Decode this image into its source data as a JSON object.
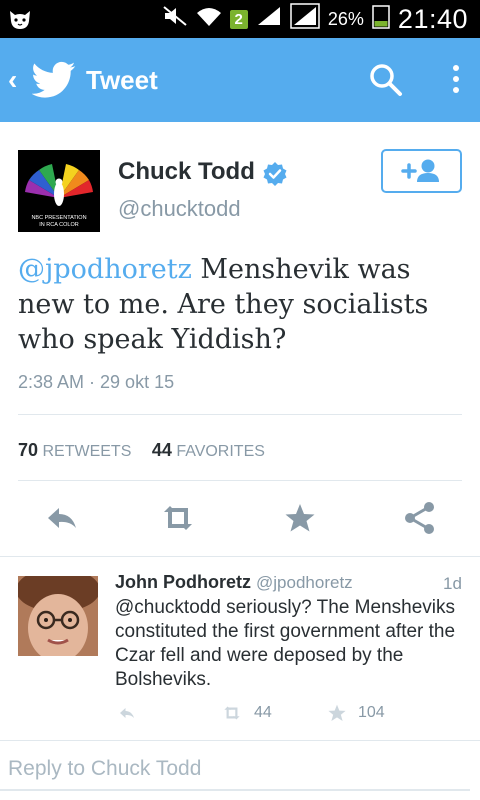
{
  "status_bar": {
    "app_icon": "cat-face-icon",
    "notification_badge": "2",
    "battery_percent": "26%",
    "time": "21:40"
  },
  "app_bar": {
    "title": "Tweet",
    "background_color": "#55acee"
  },
  "tweet": {
    "author_name": "Chuck Todd",
    "author_handle": "@chucktodd",
    "verified": true,
    "avatar_caption_line1": "NBC PRESENTATION",
    "avatar_caption_line2": "IN RCA COLOR",
    "text_mention": "@jpodhoretz",
    "text_body": " Menshevik was new to me. Are they socialists who speak Yiddish?",
    "timestamp": "2:38 AM · 29 okt 15",
    "retweets_count": "70",
    "retweets_label": "RETWEETS",
    "favorites_count": "44",
    "favorites_label": "FAVORITES"
  },
  "reply": {
    "author_name": "John Podhoretz",
    "author_handle": "@jpodhoretz",
    "time": "1d",
    "text": "@chucktodd seriously? The Mensheviks constituted the first government after the Czar fell and were deposed by the Bolsheviks.",
    "retweets": "44",
    "favorites": "104"
  },
  "composer": {
    "placeholder": "Reply to Chuck Todd"
  }
}
